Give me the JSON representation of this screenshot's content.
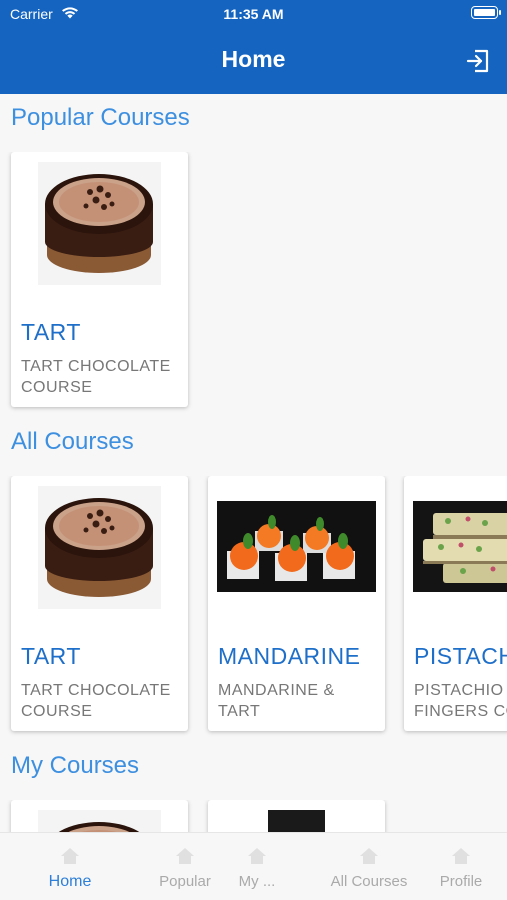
{
  "status": {
    "carrier": "Carrier",
    "time": "11:35 AM"
  },
  "app_bar": {
    "title": "Home",
    "logout_icon": "logout-icon"
  },
  "sections": {
    "popular": "Popular  Courses",
    "all": "All Courses",
    "my": "My Courses"
  },
  "popular_courses": [
    {
      "title": "TART",
      "subtitle": "TART CHOCOLATE COURSE",
      "image": "chocolate-tart"
    }
  ],
  "all_courses": [
    {
      "title": "TART",
      "subtitle": "TART CHOCOLATE COURSE",
      "image": "chocolate-tart"
    },
    {
      "title": "MANDARINE",
      "subtitle": "MANDARINE & TART",
      "image": "mandarine-pastries"
    },
    {
      "title": "PISTACHIO",
      "subtitle": "PISTACHIO FINGERS  COURSE",
      "image": "pistachio-fingers"
    }
  ],
  "my_courses": [
    {
      "image": "chocolate-tart"
    },
    {
      "image": "dark-photo"
    }
  ],
  "nav": [
    {
      "label": "Home",
      "icon": "home-icon",
      "active": true
    },
    {
      "label": "Popular",
      "icon": "popular-icon",
      "active": false
    },
    {
      "label": "My ...",
      "icon": "my-courses-icon",
      "active": false
    },
    {
      "label": "All Courses",
      "icon": "all-courses-icon",
      "active": false
    },
    {
      "label": "Profile",
      "icon": "profile-icon",
      "active": false
    }
  ],
  "colors": {
    "primary": "#1565c0",
    "section_title": "#3d8fe0",
    "card_title": "#1e6fc9",
    "nav_active": "#2d7fd8",
    "nav_inactive": "#aaaaaa"
  }
}
